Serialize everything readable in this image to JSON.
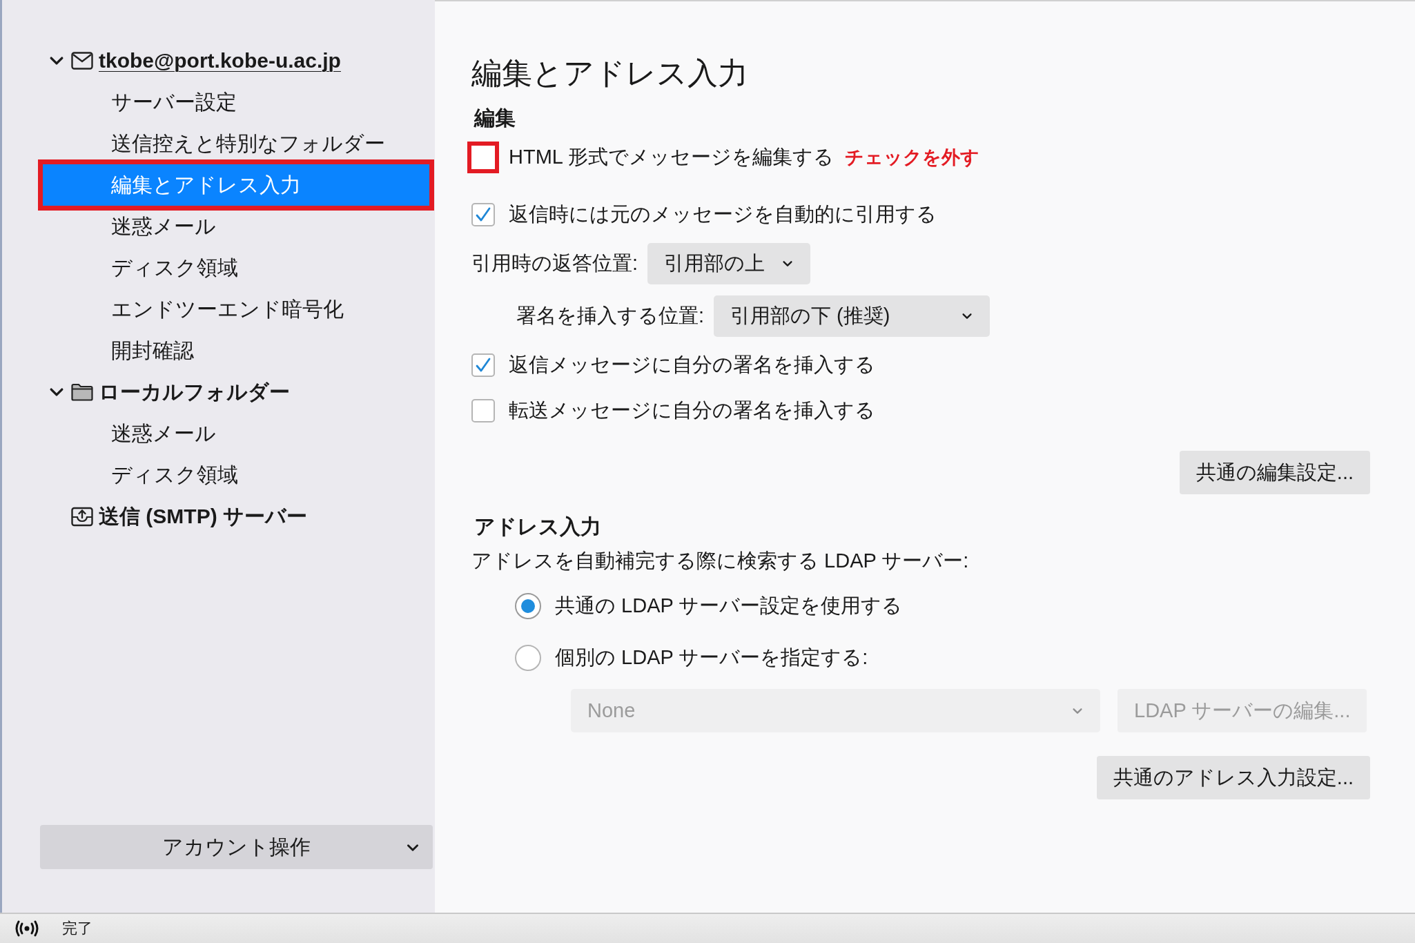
{
  "sidebar": {
    "trees": [
      {
        "label": "tkobe@port.kobe-u.ac.jp",
        "kind": "mail",
        "expanded": true,
        "children": [
          {
            "label": "サーバー設定",
            "selected": false,
            "highlighted": false
          },
          {
            "label": "送信控えと特別なフォルダー",
            "selected": false,
            "highlighted": false
          },
          {
            "label": "編集とアドレス入力",
            "selected": true,
            "highlighted": true
          },
          {
            "label": "迷惑メール",
            "selected": false,
            "highlighted": false
          },
          {
            "label": "ディスク領域",
            "selected": false,
            "highlighted": false
          },
          {
            "label": "エンドツーエンド暗号化",
            "selected": false,
            "highlighted": false
          },
          {
            "label": "開封確認",
            "selected": false,
            "highlighted": false
          }
        ]
      },
      {
        "label": "ローカルフォルダー",
        "kind": "folder",
        "expanded": true,
        "children": [
          {
            "label": "迷惑メール",
            "selected": false,
            "highlighted": false
          },
          {
            "label": "ディスク領域",
            "selected": false,
            "highlighted": false
          }
        ]
      },
      {
        "label": "送信 (SMTP) サーバー",
        "kind": "outbox"
      }
    ],
    "account_actions": "アカウント操作"
  },
  "main": {
    "title": "編集とアドレス入力",
    "sections": [
      {
        "heading": "編集",
        "rows": [
          {
            "kind": "checkbox",
            "label": "HTML 形式でメッセージを編集する",
            "checked": false,
            "highlighted": true,
            "note": "チェックを外す"
          },
          {
            "kind": "checkbox",
            "label": "返信時には元のメッセージを自動的に引用する",
            "checked": true,
            "highlighted": false
          },
          {
            "kind": "dropdown",
            "label": "引用時の返答位置:",
            "value": "引用部の上"
          },
          {
            "kind": "dropdown",
            "label": "署名を挿入する位置:",
            "value": "引用部の下 (推奨)"
          },
          {
            "kind": "checkbox",
            "label": "返信メッセージに自分の署名を挿入する",
            "checked": true,
            "highlighted": false
          },
          {
            "kind": "checkbox",
            "label": "転送メッセージに自分の署名を挿入する",
            "checked": false,
            "highlighted": false
          }
        ],
        "button": "共通の編集設定..."
      },
      {
        "heading": "アドレス入力",
        "description": "アドレスを自動補完する際に検索する LDAP サーバー:",
        "rows": [
          {
            "kind": "radio",
            "label": "共通の LDAP サーバー設定を使用する",
            "selected": true
          },
          {
            "kind": "radio",
            "label": "個別の LDAP サーバーを指定する:",
            "selected": false
          },
          {
            "kind": "ldap",
            "value": "None",
            "button": "LDAP サーバーの編集...",
            "disabled": true
          }
        ],
        "button": "共通のアドレス入力設定..."
      }
    ]
  },
  "status_bar": {
    "text": "完了"
  }
}
